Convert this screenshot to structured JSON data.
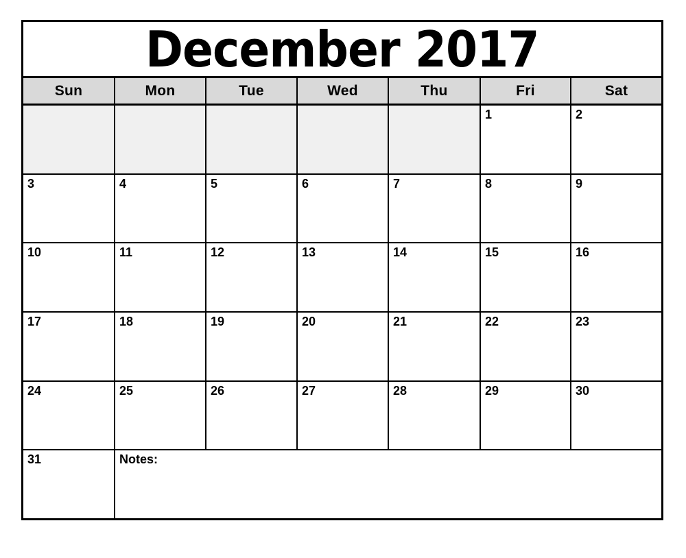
{
  "page": {
    "background_color": "#ffffff",
    "border_color": "#000000"
  },
  "calendar": {
    "title": "December 2017",
    "month": "December",
    "year": "2017",
    "header_background": "#d9d9d9",
    "blank_cell_background": "#f0f0f0",
    "day_headers": [
      {
        "label": "Sun"
      },
      {
        "label": "Mon"
      },
      {
        "label": "Tue"
      },
      {
        "label": "Wed"
      },
      {
        "label": "Thu"
      },
      {
        "label": "Fri"
      },
      {
        "label": "Sat"
      }
    ],
    "weeks": [
      {
        "days": [
          {
            "label": "",
            "blank": true
          },
          {
            "label": "",
            "blank": true
          },
          {
            "label": "",
            "blank": true
          },
          {
            "label": "",
            "blank": true
          },
          {
            "label": "",
            "blank": true
          },
          {
            "label": "1",
            "blank": false
          },
          {
            "label": "2",
            "blank": false
          }
        ]
      },
      {
        "days": [
          {
            "label": "3",
            "blank": false
          },
          {
            "label": "4",
            "blank": false
          },
          {
            "label": "5",
            "blank": false
          },
          {
            "label": "6",
            "blank": false
          },
          {
            "label": "7",
            "blank": false
          },
          {
            "label": "8",
            "blank": false
          },
          {
            "label": "9",
            "blank": false
          }
        ]
      },
      {
        "days": [
          {
            "label": "10",
            "blank": false
          },
          {
            "label": "11",
            "blank": false
          },
          {
            "label": "12",
            "blank": false
          },
          {
            "label": "13",
            "blank": false
          },
          {
            "label": "14",
            "blank": false
          },
          {
            "label": "15",
            "blank": false
          },
          {
            "label": "16",
            "blank": false
          }
        ]
      },
      {
        "days": [
          {
            "label": "17",
            "blank": false
          },
          {
            "label": "18",
            "blank": false
          },
          {
            "label": "19",
            "blank": false
          },
          {
            "label": "20",
            "blank": false
          },
          {
            "label": "21",
            "blank": false
          },
          {
            "label": "22",
            "blank": false
          },
          {
            "label": "23",
            "blank": false
          }
        ]
      },
      {
        "days": [
          {
            "label": "24",
            "blank": false
          },
          {
            "label": "25",
            "blank": false
          },
          {
            "label": "26",
            "blank": false
          },
          {
            "label": "27",
            "blank": false
          },
          {
            "label": "28",
            "blank": false
          },
          {
            "label": "29",
            "blank": false
          },
          {
            "label": "30",
            "blank": false
          }
        ]
      }
    ],
    "last_row": {
      "day": {
        "label": "31"
      },
      "notes_label": "Notes:",
      "notes_value": ""
    }
  }
}
